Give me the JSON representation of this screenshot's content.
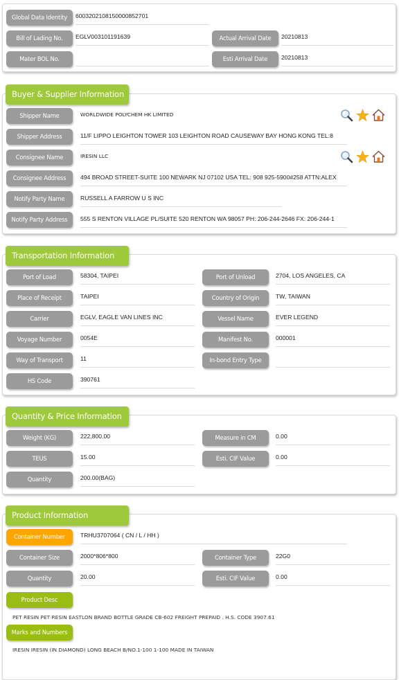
{
  "header": {
    "global_data_identity": {
      "label": "Global Data Identity",
      "value": "6003202108150000852701"
    },
    "bill_of_lading": {
      "label": "Bill of Lading No.",
      "value": "EGLV003101191639"
    },
    "actual_arrival_date": {
      "label": "Actual Arrival Date",
      "value": "20210813"
    },
    "mater_bol": {
      "label": "Mater BOL No.",
      "value": ""
    },
    "esti_arrival_date": {
      "label": "Esti Arrival Date",
      "value": "20210813"
    }
  },
  "buyer_supplier": {
    "title": "Buyer & Supplier Information",
    "shipper_name": {
      "label": "Shipper Name",
      "value": "WORLDWIDE POLYCHEM HK LIMITED"
    },
    "shipper_address": {
      "label": "Shipper Address",
      "value": "11/F LIPPO LEIGHTON TOWER 103 LEIGHTON ROAD CAUSEWAY BAY HONG KONG TEL:8"
    },
    "consignee_name": {
      "label": "Consignee Name",
      "value": "IRESIN LLC"
    },
    "consignee_address": {
      "label": "Consignee Address",
      "value": "494 BROAD STREET-SUITE 100 NEWARK NJ 07102 USA TEL: 908 925-5900#258 ATTN:ALEX"
    },
    "notify_party_name": {
      "label": "Notify Party Name",
      "value": "RUSSELL A FARROW U S INC"
    },
    "notify_party_address": {
      "label": "Notify Party Address",
      "value": "555 S RENTON VILLAGE PL/SUITE 520 RENTON WA 98057 PH: 206-244-2646 FX: 206-244-1"
    },
    "icons": [
      "search-icon",
      "star-icon",
      "home-icon"
    ]
  },
  "transportation": {
    "title": "Transportation Information",
    "port_of_load": {
      "label": "Port of Load",
      "value": "58304, TAIPEI"
    },
    "port_of_unload": {
      "label": "Port of Unload",
      "value": "2704, LOS ANGELES, CA"
    },
    "place_of_receipt": {
      "label": "Place of Receipt",
      "value": "TAIPEI"
    },
    "country_of_origin": {
      "label": "Country of Origin",
      "value": "TW, TAIWAN"
    },
    "carrier": {
      "label": "Carrier",
      "value": "EGLV, EAGLE VAN LINES INC"
    },
    "vessel_name": {
      "label": "Vessel Name",
      "value": "EVER LEGEND"
    },
    "voyage_number": {
      "label": "Voyage Number",
      "value": "0054E"
    },
    "manifest_no": {
      "label": "Manifest No.",
      "value": "000001"
    },
    "way_of_transport": {
      "label": "Way of Transport",
      "value": "11"
    },
    "in_bond_entry_type": {
      "label": "In-bond Entry Type",
      "value": ""
    },
    "hs_code": {
      "label": "HS Code",
      "value": "390761"
    }
  },
  "quantity_price": {
    "title": "Quantity & Price Information",
    "weight": {
      "label": "Weight (KG)",
      "value": "222,800.00"
    },
    "measure": {
      "label": "Measure in CM",
      "value": "0.00"
    },
    "teus": {
      "label": "TEUS",
      "value": "15.00"
    },
    "esti_cif": {
      "label": "Esti. CIF Value",
      "value": "0.00"
    },
    "quantity": {
      "label": "Quantity",
      "value": "200.00(BAG)"
    }
  },
  "product": {
    "title": "Product Information",
    "container_number": {
      "label": "Container Number",
      "value": "TRHU3707064 ( CN / L / HH )"
    },
    "container_size": {
      "label": "Container Size",
      "value": "2000*806*800"
    },
    "container_type": {
      "label": "Container Type",
      "value": "22G0"
    },
    "quantity": {
      "label": "Quantity",
      "value": "20.00"
    },
    "esti_cif": {
      "label": "Esti. CIF Value",
      "value": "0.00"
    },
    "product_desc": {
      "label": "Product Desc",
      "value": "PET RESIN PET RESIN EASTLON BRAND BOTTLE GRADE CB-602 FREIGHT PREPAID . H.S. CODE 3907.61"
    },
    "marks_numbers": {
      "label": "Marks and Numbers",
      "value": "IRESIN IRESIN (IN DIAMOND) LONG BEACH B/NO.1-100 1-100 MADE IN TAIWAN"
    }
  },
  "colors": {
    "section_tab": "#9dc93a",
    "label_gray": "#9b9b9b",
    "label_orange": "#ffa500",
    "label_green": "#9bbc12"
  }
}
